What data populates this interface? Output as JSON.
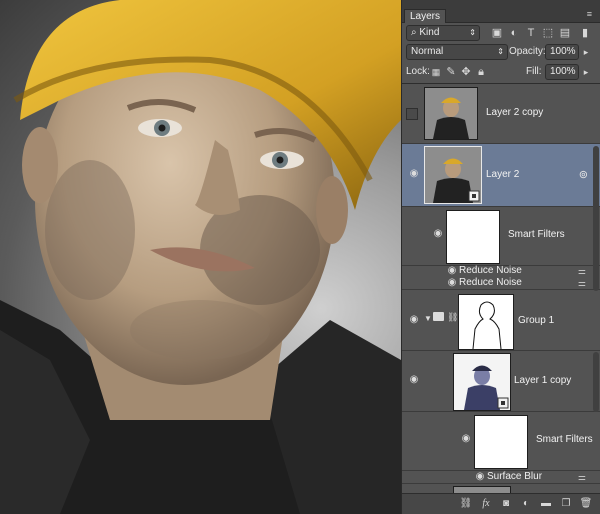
{
  "panel": {
    "tab_label": "Layers",
    "filter": {
      "label": "Kind",
      "icon": "search-icon"
    },
    "blend_mode": "Normal",
    "opacity_label": "Opacity:",
    "opacity_value": "100%",
    "lock_label": "Lock:",
    "fill_label": "Fill:",
    "fill_value": "100%"
  },
  "layers": [
    {
      "name": "Layer 2 copy",
      "visible": false,
      "selected": false
    },
    {
      "name": "Layer 2",
      "visible": true,
      "selected": true
    },
    {
      "name": "Smart Filters",
      "visible": true
    },
    {
      "filters": [
        "Reduce Noise",
        "Reduce Noise"
      ]
    },
    {
      "name": "Group 1",
      "visible": true
    },
    {
      "name": "Layer 1 copy",
      "visible": true
    },
    {
      "name": "Smart Filters",
      "visible": true
    },
    {
      "filters": [
        "Surface Blur"
      ]
    }
  ],
  "footer": {
    "icons": [
      "link-icon",
      "fx-icon",
      "mask-icon",
      "adjustment-icon",
      "folder-icon",
      "new-layer-icon",
      "trash-icon"
    ],
    "fx_label": "fx"
  },
  "colors": {
    "panel_bg": "#535353",
    "selected_row": "#6b7b96",
    "helmet": "#e0b12c"
  }
}
